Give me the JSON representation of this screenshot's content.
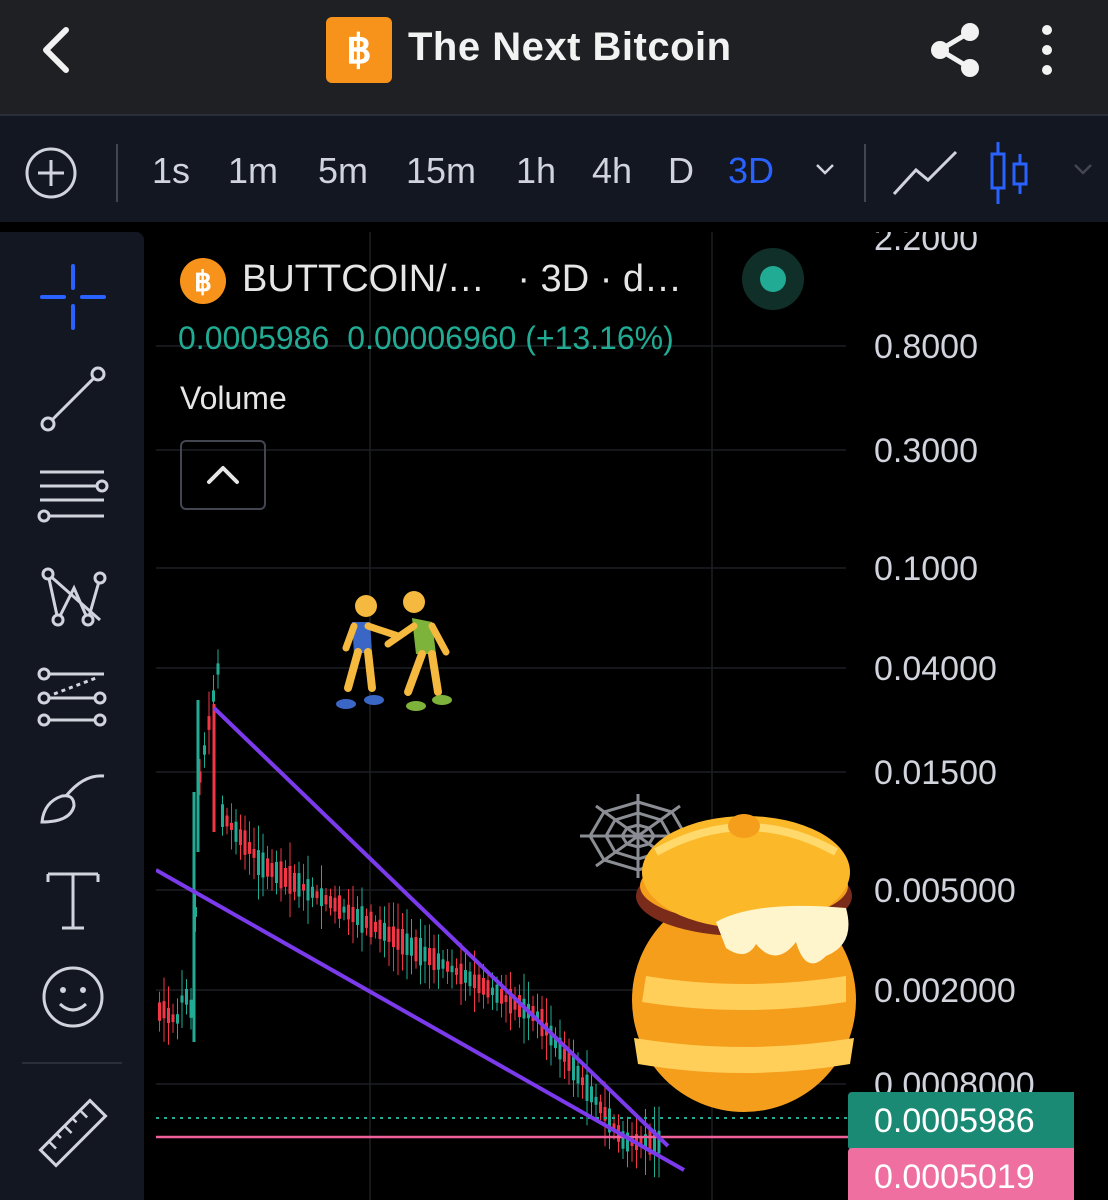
{
  "header": {
    "title": "The Next Bitcoin",
    "logo_glyph": "฿"
  },
  "toolbar": {
    "intervals": [
      "1s",
      "1m",
      "5m",
      "15m",
      "1h",
      "4h",
      "D",
      "3D"
    ],
    "active_interval": "3D",
    "accent_color": "#2962ff"
  },
  "left_tools": [
    "crosshair-icon",
    "trend-line-icon",
    "horizontal-lines-icon",
    "pattern-icon",
    "prediction-icon",
    "brush-icon",
    "text-icon",
    "emoji-icon",
    "ruler-icon"
  ],
  "chart": {
    "legend": {
      "symbol": "BUTTCOIN/…",
      "meta": "· 3D · d…",
      "price": "0.0005986",
      "change": "0.00006960 (+13.16%)"
    },
    "volume_label": "Volume",
    "y_axis_labels": [
      "2.2000",
      "0.8000",
      "0.3000",
      "0.1000",
      "0.04000",
      "0.01500",
      "0.005000",
      "0.002000",
      "0.0008000"
    ],
    "current_price_tag": "0.0005986",
    "line_price_tag": "0.0005019",
    "colors": {
      "up": "#22ab94",
      "down": "#f23645",
      "trendline": "#7c3aed",
      "hline": "#f0609a"
    },
    "stickers": [
      "wrestlers-sticker",
      "spider-web-sticker",
      "honey-pot-sticker"
    ]
  }
}
